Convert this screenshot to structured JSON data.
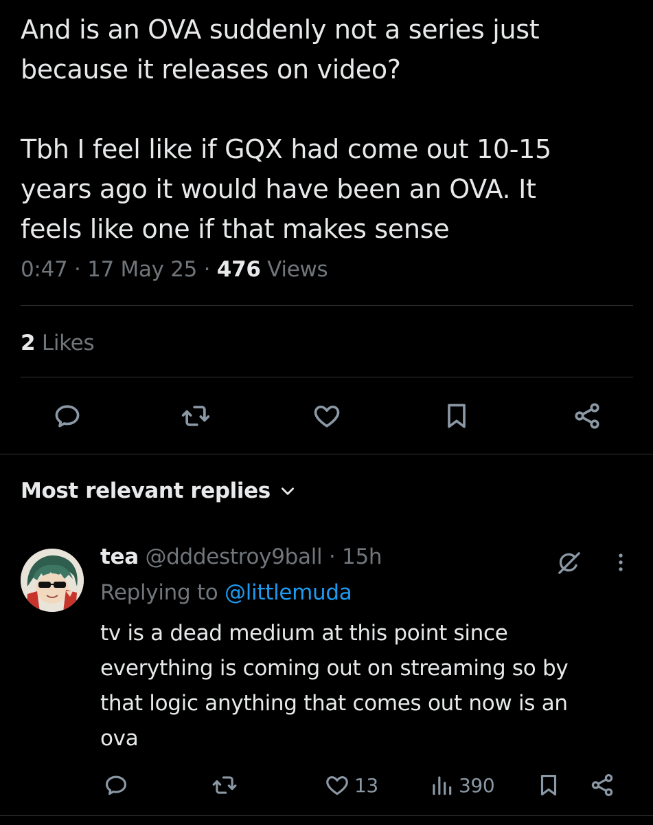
{
  "tweet": {
    "text_lines_1": [
      "And is an OVA suddenly not a series just",
      "because it releases on video?"
    ],
    "text_lines_2": [
      "Tbh I feel like if GQX had come out 10-15",
      "years ago it would have been an OVA. It",
      "feels like one if that makes sense"
    ],
    "time": "0:47",
    "date": "17 May 25",
    "views_count": "476",
    "views_label": "Views",
    "likes_count": "2",
    "likes_label": "Likes",
    "separator": "·"
  },
  "actions": {
    "reply_icon": "reply-icon",
    "retweet_icon": "retweet-icon",
    "like_icon": "heart-icon",
    "bookmark_icon": "bookmark-icon",
    "share_icon": "share-icon"
  },
  "replies_section": {
    "sort_label": "Most relevant replies"
  },
  "reply": {
    "display_name": "tea",
    "handle": "@dddestroy9ball",
    "separator": "·",
    "age": "15h",
    "replying_prefix": "Replying to",
    "replying_to": "@littlemuda",
    "text_lines": [
      "tv is a dead medium at this point since",
      "everything is coming out on streaming so by",
      "that logic anything that comes out now is an",
      "ova"
    ],
    "like_count": "13",
    "view_count": "390"
  },
  "colors": {
    "background": "#000000",
    "text_primary": "#e7e9ea",
    "text_secondary": "#71767b",
    "link": "#1d9bf0",
    "divider": "#2f3336"
  }
}
